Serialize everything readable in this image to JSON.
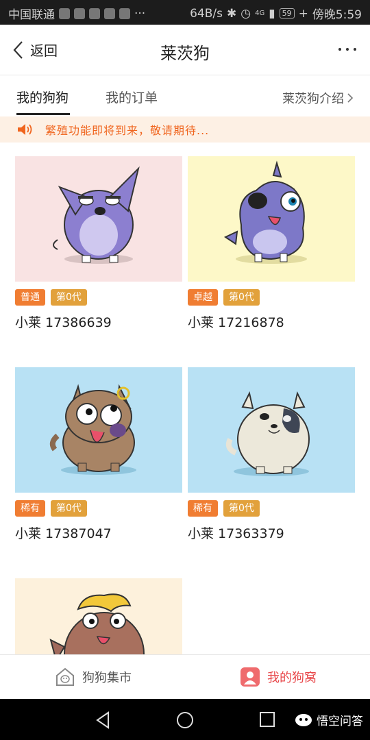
{
  "status_bar": {
    "carrier": "中国联通",
    "network_speed": "64B/s",
    "signal": "4G",
    "battery": "59",
    "clock": "傍晚5:59"
  },
  "header": {
    "back_label": "返回",
    "title": "莱茨狗"
  },
  "tabs": {
    "my_dogs": "我的狗狗",
    "my_orders": "我的订单",
    "intro": "莱茨狗介绍"
  },
  "notice": {
    "text": "繁殖功能即将到来，敬请期待..."
  },
  "dogs": [
    {
      "rarity": "普通",
      "generation": "第0代",
      "name": "小莱 17386639",
      "bg": "#f9e3e3"
    },
    {
      "rarity": "卓越",
      "generation": "第0代",
      "name": "小莱 17216878",
      "bg": "#fdf8c8"
    },
    {
      "rarity": "稀有",
      "generation": "第0代",
      "name": "小莱 17387047",
      "bg": "#b8e1f4"
    },
    {
      "rarity": "稀有",
      "generation": "第0代",
      "name": "小莱 17363379",
      "bg": "#b8e1f4"
    },
    {
      "bg": "#fdf1dc"
    }
  ],
  "bottom_nav": {
    "market": "狗狗集市",
    "kennel": "我的狗窝"
  },
  "watermark": "悟空问答",
  "colors": {
    "accent_orange": "#f0651e",
    "badge_rarity": "#f07d32",
    "badge_generation": "#e2a13b",
    "active_nav": "#e8474a"
  }
}
